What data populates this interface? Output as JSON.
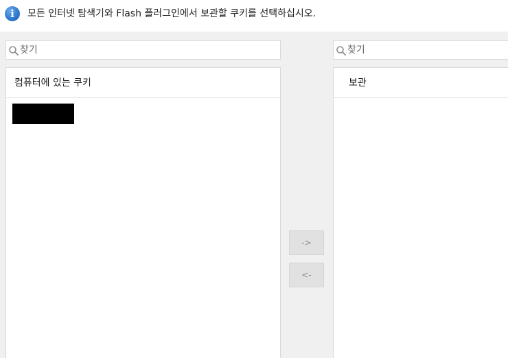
{
  "banner": {
    "icon": "info-icon",
    "icon_glyph": "i",
    "message": "모든 인터넷 탐색기와 Flash 플러그인에서 보관할 쿠키를 선택하십시오."
  },
  "left_pane": {
    "search_placeholder": "찾기",
    "header": "컴퓨터에 있는 쿠키",
    "items": [
      "[redacted]"
    ]
  },
  "right_pane": {
    "search_placeholder": "찾기",
    "header": "보관",
    "items": []
  },
  "buttons": {
    "move_right_label": "->",
    "move_left_label": "<-"
  },
  "colors": {
    "info_icon": "#2f7bd0",
    "content_background": "#f0f0f0",
    "button_background": "#e1e1e1",
    "button_text_disabled": "#8a8a8a"
  }
}
